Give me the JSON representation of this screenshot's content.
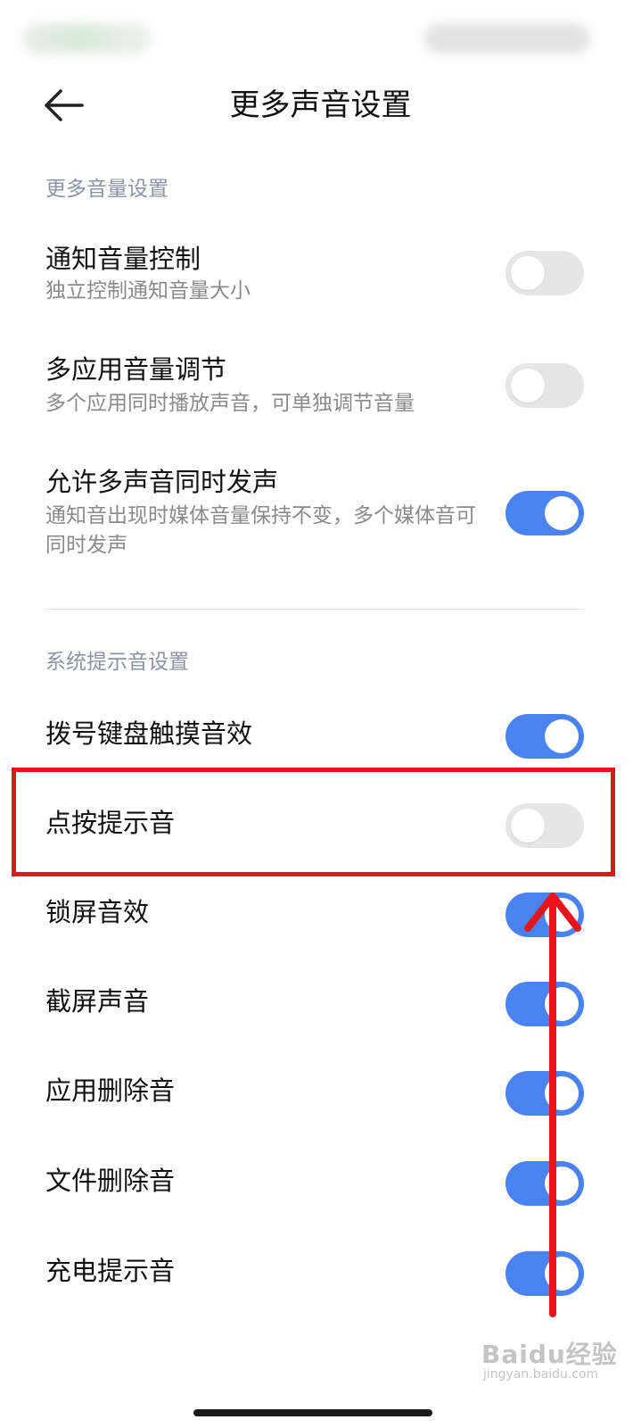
{
  "header": {
    "title": "更多声音设置",
    "back_icon": "arrow-left-icon"
  },
  "sections": [
    {
      "header": "更多音量设置",
      "items": [
        {
          "title": "通知音量控制",
          "subtitle": "独立控制通知音量大小",
          "enabled": false
        },
        {
          "title": "多应用音量调节",
          "subtitle": "多个应用同时播放声音，可单独调节音量",
          "enabled": false
        },
        {
          "title": "允许多声音同时发声",
          "subtitle": "通知音出现时媒体音量保持不变，多个媒体音可同时发声",
          "enabled": true
        }
      ]
    },
    {
      "header": "系统提示音设置",
      "items": [
        {
          "title": "拨号键盘触摸音效",
          "enabled": true
        },
        {
          "title": "点按提示音",
          "enabled": false
        },
        {
          "title": "锁屏音效",
          "enabled": true
        },
        {
          "title": "截屏声音",
          "enabled": true
        },
        {
          "title": "应用删除音",
          "enabled": true
        },
        {
          "title": "文件删除音",
          "enabled": true
        },
        {
          "title": "充电提示音",
          "enabled": true
        }
      ]
    }
  ],
  "watermark": {
    "brand": "Baidu经验",
    "site": "jingyan.baidu.com"
  },
  "colors": {
    "toggle_on": "#4a83f0",
    "toggle_off": "#e6e6e6",
    "annotation_red": "#e8141b",
    "section_header": "#8b93a6"
  }
}
